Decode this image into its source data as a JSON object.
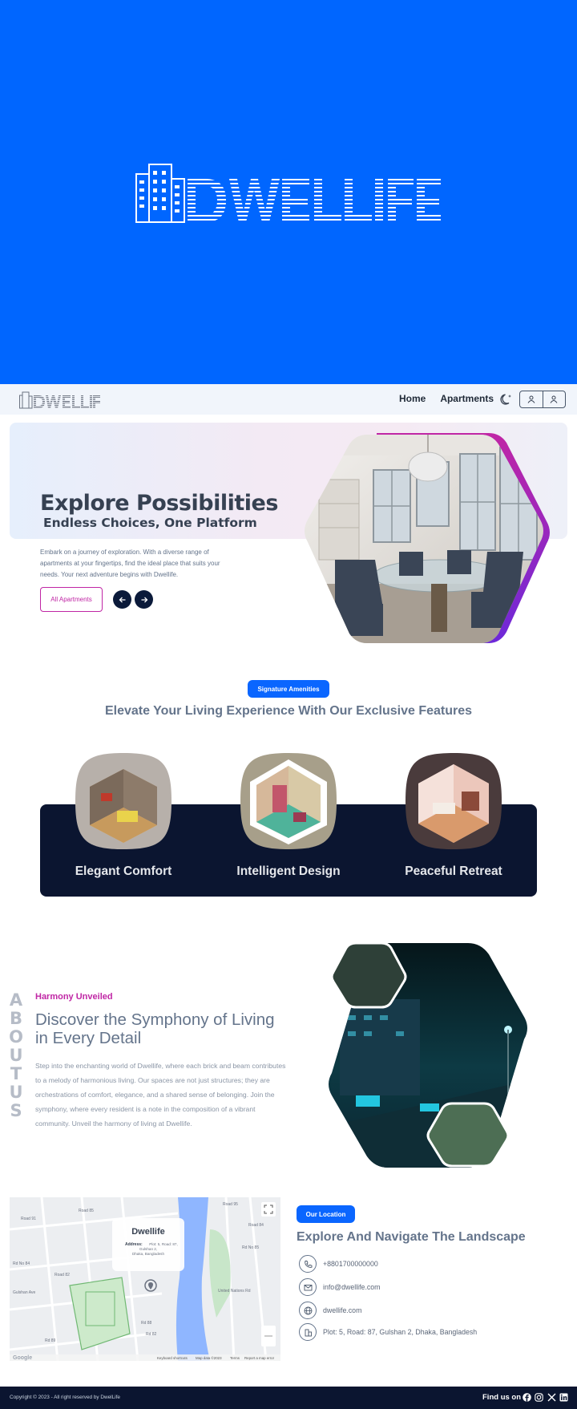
{
  "brand": {
    "name": "DWELLIFE",
    "accent": "#0066ff",
    "magenta": "#c026a5",
    "navy": "#0b1530"
  },
  "nav": {
    "links": [
      "Home",
      "Apartments"
    ],
    "icons": [
      "moon-icon",
      "user-icon",
      "user-icon"
    ]
  },
  "hero": {
    "title": "Explore Possibilities",
    "subtitle": "Endless Choices, One Platform",
    "description": "Embark on a journey of exploration. With a diverse range of apartments at your fingertips, find the ideal place that suits your needs. Your next adventure begins with Dwellife.",
    "cta": "All Apartments",
    "prev_icon": "arrow-left-icon",
    "next_icon": "arrow-right-icon"
  },
  "amenities": {
    "badge": "Signature Amenities",
    "heading": "Elevate Your Living Experience With Our Exclusive Features",
    "items": [
      {
        "label": "Elegant Comfort"
      },
      {
        "label": "Intelligent Design"
      },
      {
        "label": "Peaceful Retreat"
      }
    ]
  },
  "about": {
    "vertical": [
      "A",
      "B",
      "O",
      "U",
      "T",
      "U",
      "S"
    ],
    "kicker": "Harmony Unveiled",
    "title": "Discover the Symphony of Living in Every Detail",
    "text": "Step into the enchanting world of Dwellife, where each brick and beam contributes to a melody of harmonious living. Our spaces are not just structures; they are orchestrations of comfort, elegance, and a shared sense of belonging. Join the symphony, where every resident is a note in the composition of a vibrant community. Unveil the harmony of living at Dwellife."
  },
  "location": {
    "badge": "Our Location",
    "heading": "Explore And Navigate The Landscape",
    "map": {
      "card_title": "Dwellife",
      "card_address_label": "Address:",
      "card_address": "Plot: 5, Road: 87, Gulshan 2, Dhaka, Bangladesh",
      "roads": [
        "Road 91",
        "Road 85",
        "Rd No 84",
        "Road 82",
        "Rd 82",
        "Rd 89",
        "Rd 88",
        "Gulshan Ave",
        "Road 84",
        "United Nations Rd",
        "Rd No 85",
        "Road 95"
      ],
      "footer": [
        "Keyboard shortcuts",
        "Map data ©2023",
        "Terms",
        "Report a map error"
      ],
      "google": "Google"
    },
    "contacts": [
      {
        "icon": "phone-icon",
        "text": "+8801700000000"
      },
      {
        "icon": "mail-icon",
        "text": "info@dwellife.com"
      },
      {
        "icon": "globe-icon",
        "text": "dwellife.com"
      },
      {
        "icon": "building-icon",
        "text": "Plot: 5, Road: 87, Gulshan 2, Dhaka, Bangladesh"
      }
    ]
  },
  "footer": {
    "copyright": "Copyright © 2023 - All right reserved by DwelLife",
    "find_us": "Find us on",
    "socials": [
      "facebook-icon",
      "instagram-icon",
      "x-icon",
      "linkedin-icon"
    ]
  }
}
